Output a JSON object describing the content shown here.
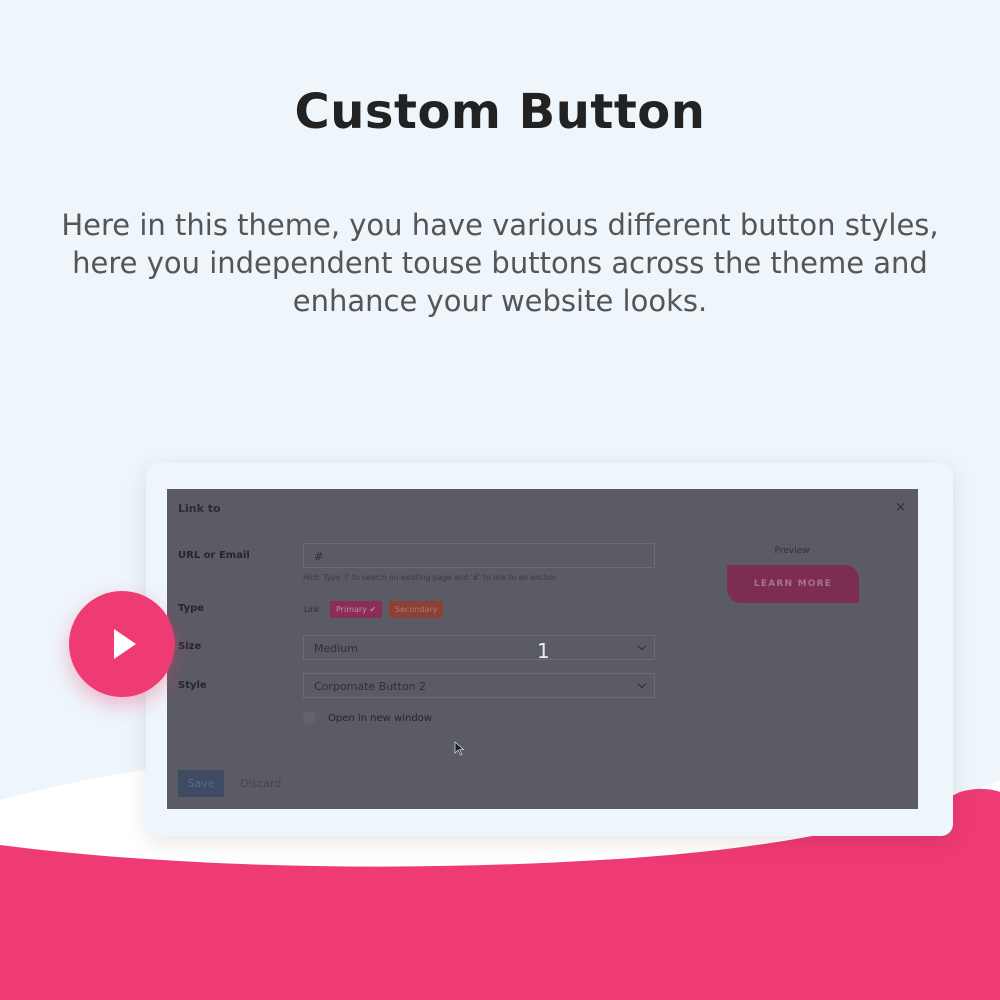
{
  "hero": {
    "title": "Custom Button",
    "description": "Here in this theme, you have various different button styles, here you independent touse buttons across the theme and enhance your website looks."
  },
  "colors": {
    "accent": "#ef3b73",
    "background": "#eef5fb",
    "overlay": "#5a5b65"
  },
  "dialog": {
    "title": "Link to",
    "close_icon": "×",
    "url_label": "URL or Email",
    "url_value": "#",
    "url_hint": "Hint: Type '/' to search on existing page and '#' to link to an anchor.",
    "type_label": "Type",
    "type_link_text": "Link",
    "type_primary": "Primary ✔",
    "type_secondary": "Secondary",
    "size_label": "Size",
    "size_value": "Medium",
    "style_label": "Style",
    "style_value": "Corpomate Button 2",
    "open_new_window_label": "Open in new window",
    "save_label": "Save",
    "discard_label": "Discard",
    "preview_label": "Preview",
    "preview_button": "LEARN MORE",
    "step_number": "1"
  },
  "icons": {
    "play": "play-icon",
    "close": "close-icon",
    "cursor": "cursor-arrow-icon"
  }
}
